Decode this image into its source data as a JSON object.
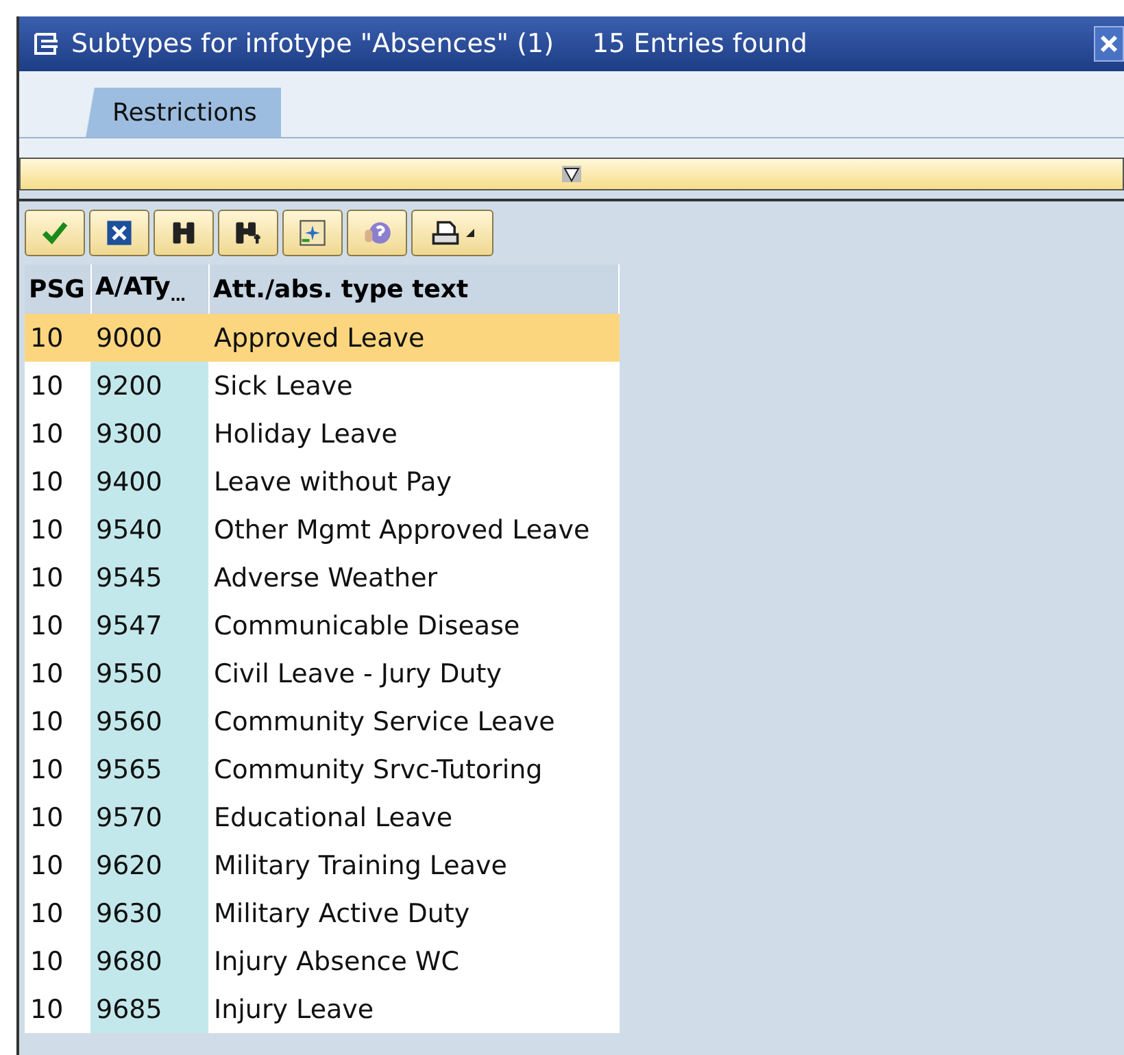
{
  "window": {
    "title": "Subtypes for infotype \"Absences\" (1)",
    "entries": "15 Entries found"
  },
  "tabs": [
    {
      "label": "Restrictions",
      "selected": true
    }
  ],
  "toolbar": [
    {
      "kind": "check"
    },
    {
      "kind": "cancel"
    },
    {
      "kind": "find"
    },
    {
      "kind": "find-next"
    },
    {
      "kind": "new"
    },
    {
      "kind": "help"
    },
    {
      "kind": "print"
    }
  ],
  "table": {
    "columns": [
      {
        "label": "PSG"
      },
      {
        "label": "A/ATy",
        "truncation": "…"
      },
      {
        "label": "Att./abs. type text"
      }
    ],
    "rows": [
      {
        "psg": "10",
        "type": "9000",
        "text": "Approved Leave",
        "selected": true
      },
      {
        "psg": "10",
        "type": "9200",
        "text": "Sick Leave",
        "selected": false
      },
      {
        "psg": "10",
        "type": "9300",
        "text": "Holiday Leave",
        "selected": false
      },
      {
        "psg": "10",
        "type": "9400",
        "text": "Leave without Pay",
        "selected": false
      },
      {
        "psg": "10",
        "type": "9540",
        "text": "Other Mgmt Approved Leave",
        "selected": false
      },
      {
        "psg": "10",
        "type": "9545",
        "text": "Adverse Weather",
        "selected": false
      },
      {
        "psg": "10",
        "type": "9547",
        "text": "Communicable Disease",
        "selected": false
      },
      {
        "psg": "10",
        "type": "9550",
        "text": "Civil Leave - Jury Duty",
        "selected": false
      },
      {
        "psg": "10",
        "type": "9560",
        "text": "Community Service Leave",
        "selected": false
      },
      {
        "psg": "10",
        "type": "9565",
        "text": "Community Srvc-Tutoring",
        "selected": false
      },
      {
        "psg": "10",
        "type": "9570",
        "text": "Educational Leave",
        "selected": false
      },
      {
        "psg": "10",
        "type": "9620",
        "text": "Military Training Leave",
        "selected": false
      },
      {
        "psg": "10",
        "type": "9630",
        "text": "Military Active Duty",
        "selected": false
      },
      {
        "psg": "10",
        "type": "9680",
        "text": "Injury Absence WC",
        "selected": false
      },
      {
        "psg": "10",
        "type": "9685",
        "text": "Injury Leave",
        "selected": false
      }
    ]
  }
}
